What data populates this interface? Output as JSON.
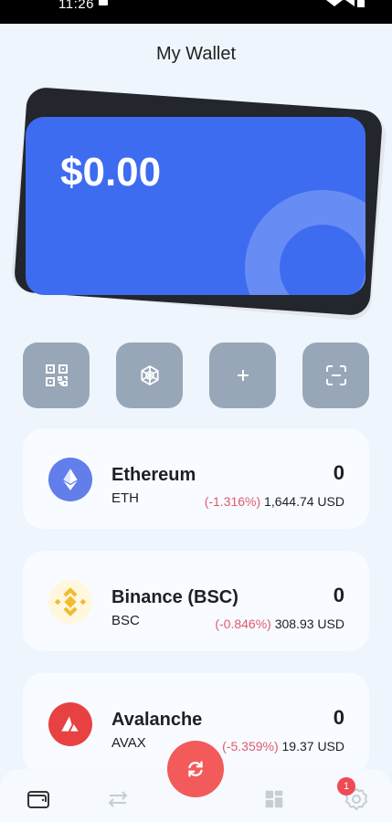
{
  "status_bar": {
    "time": "11:26"
  },
  "header": {
    "title": "My Wallet"
  },
  "wallet_card": {
    "balance": "$0.00"
  },
  "actions": [
    {
      "name": "qr-code",
      "icon": "qr-code-icon"
    },
    {
      "name": "openai",
      "icon": "openai-icon"
    },
    {
      "name": "add",
      "icon": "plus-icon"
    },
    {
      "name": "scan",
      "icon": "scan-icon"
    }
  ],
  "coins": [
    {
      "name": "Ethereum",
      "symbol": "ETH",
      "balance": "0",
      "change": "(-1.316%)",
      "price": "1,644.74 USD",
      "color": "#627eea"
    },
    {
      "name": "Binance (BSC)",
      "symbol": "BSC",
      "balance": "0",
      "change": "(-0.846%)",
      "price": "308.93 USD",
      "color": "#f3ba2f"
    },
    {
      "name": "Avalanche",
      "symbol": "AVAX",
      "balance": "0",
      "change": "(-5.359%)",
      "price": "19.37 USD",
      "color": "#e84142"
    }
  ],
  "bottom_nav": {
    "items": [
      "wallet-icon",
      "transfer-icon",
      "dashboard-icon",
      "settings-icon"
    ],
    "swap_icon": "swap-refresh-icon",
    "notification_count": "1"
  },
  "colors": {
    "background": "#eef5fc",
    "card_blue": "#3d6cf0",
    "action_grey": "#98a7b7",
    "negative_change": "#e05b6e",
    "swap_red": "#f35a5a"
  }
}
